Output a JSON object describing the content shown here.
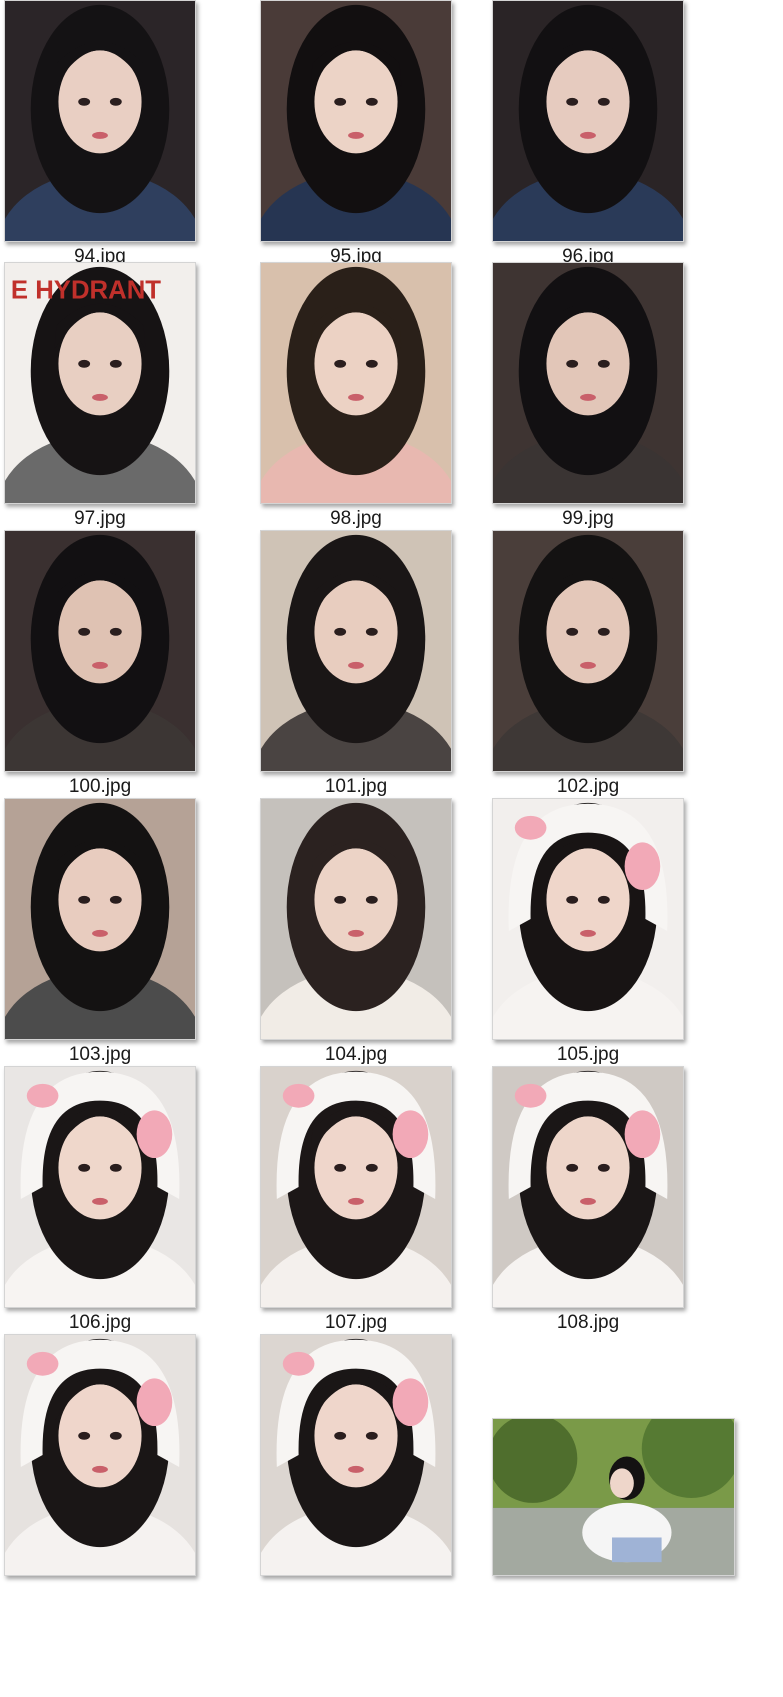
{
  "files": [
    {
      "name": "94.jpg",
      "bg": "#2b2528",
      "skin": "#e9cfc3",
      "hair": "#141214",
      "shirt": "#2f3f5e",
      "orient": "portrait"
    },
    {
      "name": "95.jpg",
      "bg": "#4a3b38",
      "skin": "#ecd3c6",
      "hair": "#120f10",
      "shirt": "#263552",
      "orient": "portrait"
    },
    {
      "name": "96.jpg",
      "bg": "#2a2426",
      "skin": "#e6cbbf",
      "hair": "#121012",
      "shirt": "#2a3a58",
      "orient": "portrait"
    },
    {
      "name": "97.jpg",
      "bg": "#f2efec",
      "skin": "#e8cfc2",
      "hair": "#161314",
      "shirt": "#6a6a6a",
      "orient": "portrait",
      "sign": "E HYDRANT"
    },
    {
      "name": "98.jpg",
      "bg": "#d8c0ac",
      "skin": "#ecd2c4",
      "hair": "#2a2019",
      "shirt": "#e8b8b0",
      "orient": "portrait"
    },
    {
      "name": "99.jpg",
      "bg": "#3e3432",
      "skin": "#e2c6b8",
      "hair": "#121012",
      "shirt": "#3a3433",
      "orient": "portrait"
    },
    {
      "name": "100.jpg",
      "bg": "#3a3030",
      "skin": "#dfc2b3",
      "hair": "#121012",
      "shirt": "#3c3634",
      "orient": "portrait"
    },
    {
      "name": "101.jpg",
      "bg": "#cfc3b6",
      "skin": "#e8cdbf",
      "hair": "#1a1616",
      "shirt": "#4a4442",
      "orient": "portrait"
    },
    {
      "name": "102.jpg",
      "bg": "#4a3e3a",
      "skin": "#e4c8ba",
      "hair": "#141212",
      "shirt": "#3e3836",
      "orient": "portrait"
    },
    {
      "name": "103.jpg",
      "bg": "#b5a296",
      "skin": "#e8ccbf",
      "hair": "#141212",
      "shirt": "#4c4c4c",
      "orient": "portrait"
    },
    {
      "name": "104.jpg",
      "bg": "#c5c1bc",
      "skin": "#ecd3c6",
      "hair": "#2b2220",
      "shirt": "#f1ece6",
      "orient": "portrait"
    },
    {
      "name": "105.jpg",
      "bg": "#f2efed",
      "skin": "#efd6ca",
      "hair": "#181414",
      "shirt": "#f6f3f1",
      "orient": "portrait",
      "hat": true
    },
    {
      "name": "106.jpg",
      "bg": "#e9e6e4",
      "skin": "#efd7cb",
      "hair": "#1a1616",
      "shirt": "#f7f4f2",
      "orient": "portrait",
      "hat": true
    },
    {
      "name": "107.jpg",
      "bg": "#d9d2cc",
      "skin": "#efd6cb",
      "hair": "#1c1717",
      "shirt": "#f4f0ed",
      "orient": "portrait",
      "hat": true
    },
    {
      "name": "108.jpg",
      "bg": "#cfc9c4",
      "skin": "#eed6ca",
      "hair": "#1a1616",
      "shirt": "#f6f3f1",
      "orient": "portrait",
      "hat": true
    },
    {
      "name": "",
      "bg": "#e6e2df",
      "skin": "#efd6cb",
      "hair": "#1a1616",
      "shirt": "#f5f2f0",
      "orient": "portrait",
      "hat": true
    },
    {
      "name": "",
      "bg": "#dcd6d1",
      "skin": "#efd6cb",
      "hair": "#1a1616",
      "shirt": "#f5f2f0",
      "orient": "portrait",
      "hat": true
    },
    {
      "name": "",
      "bg": "#5d7a3a",
      "skin": "#eed6ca",
      "hair": "#141212",
      "shirt": "#f5f5f5",
      "orient": "landscape"
    }
  ],
  "icons": {
    "thumbnail": "image-thumbnail-icon"
  }
}
